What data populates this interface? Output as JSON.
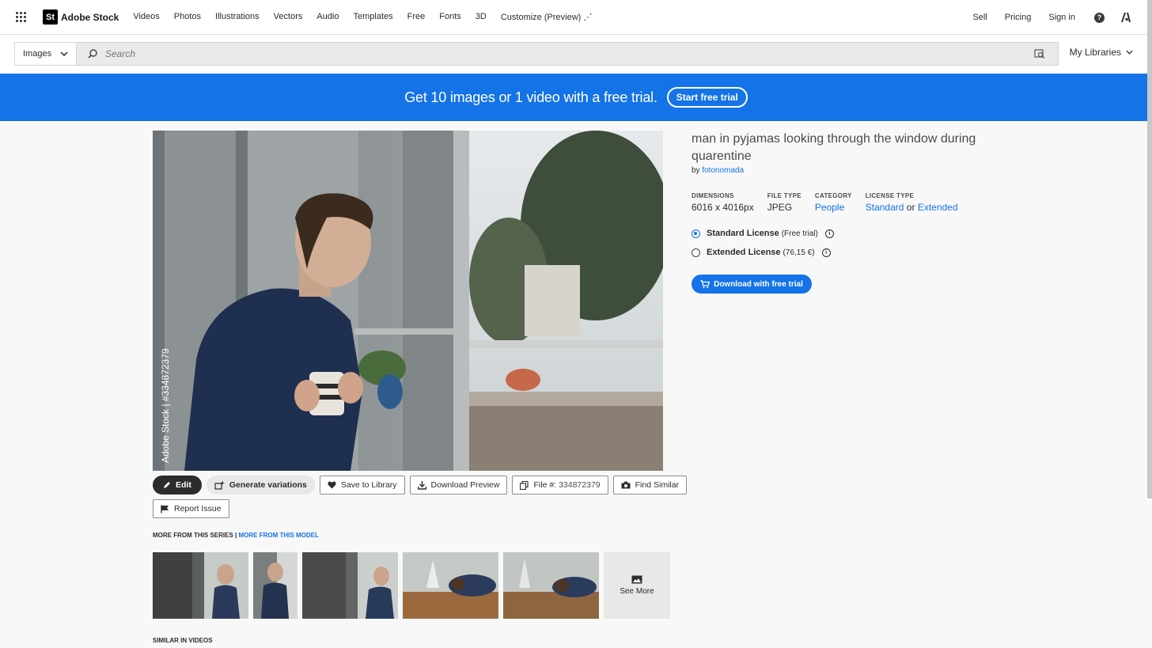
{
  "nav": {
    "brand": "Adobe Stock",
    "brand_mark": "St",
    "links": [
      "Videos",
      "Photos",
      "Illustrations",
      "Vectors",
      "Audio",
      "Templates",
      "Free",
      "Fonts",
      "3D",
      "Customize (Preview) ⋰"
    ],
    "sell": "Sell",
    "pricing": "Pricing",
    "signin": "Sign in",
    "help": "?"
  },
  "search": {
    "type": "Images",
    "placeholder": "Search",
    "my_libraries": "My Libraries"
  },
  "banner": {
    "text": "Get 10 images or 1 video with a free trial.",
    "button": "Start free trial"
  },
  "asset": {
    "title": "man in pyjamas looking through the window during quarentine",
    "by_prefix": "by",
    "author": "fotonomada",
    "watermark": "Adobe Stock | #334872379",
    "meta": {
      "dimensions_label": "DIMENSIONS",
      "dimensions_value": "6016 x 4016px",
      "filetype_label": "FILE TYPE",
      "filetype_value": "JPEG",
      "category_label": "CATEGORY",
      "category_value": "People",
      "license_label": "LICENSE TYPE",
      "license_standard": "Standard",
      "license_or": "or",
      "license_extended": "Extended"
    },
    "licenses": {
      "standard_name": "Standard License",
      "standard_price": "(Free trial)",
      "extended_name": "Extended License",
      "extended_price": "(76,15 €)"
    },
    "download_button": "Download with free trial"
  },
  "toolbar": {
    "edit": "Edit",
    "generate": "Generate variations",
    "save": "Save to Library",
    "download_preview": "Download Preview",
    "file_label": "File #:",
    "file_number": "334872379",
    "find_similar": "Find Similar",
    "report": "Report Issue"
  },
  "series": {
    "label": "MORE FROM THIS SERIES",
    "separator": "|",
    "model_link": "MORE FROM THIS MODEL",
    "see_more": "See More"
  },
  "similar_videos": "SIMILAR IN VIDEOS",
  "colors": {
    "accent": "#1473e6",
    "text": "#2c2c2c"
  }
}
